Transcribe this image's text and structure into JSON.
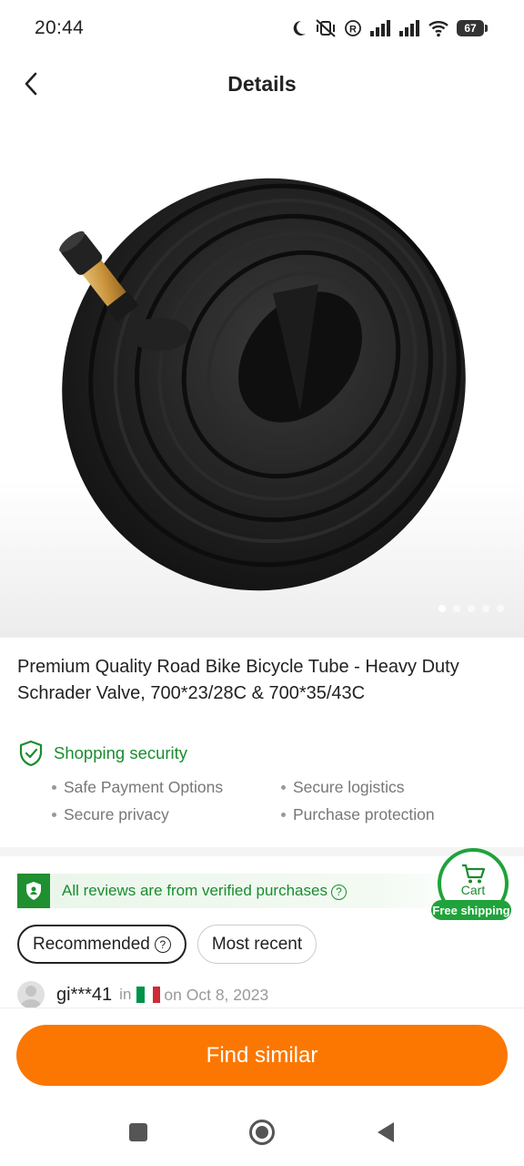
{
  "status_bar": {
    "time": "20:44",
    "battery": "67",
    "icons": [
      "moon-icon",
      "mute-vibrate-icon",
      "registered-icon",
      "signal-icon",
      "signal-icon",
      "wifi-icon",
      "battery-icon"
    ]
  },
  "header": {
    "title": "Details",
    "back_icon": "chevron-left-icon"
  },
  "gallery": {
    "image_name": "bicycle inner tube",
    "total_images": 5,
    "active_index": 1
  },
  "product": {
    "title": "Premium Quality Road Bike Bicycle Tube - Heavy Duty Schrader Valve, 700*23/28C & 700*35/43C"
  },
  "security": {
    "title": "Shopping security",
    "items": [
      "Safe Payment Options",
      "Secure logistics",
      "Secure privacy",
      "Purchase protection"
    ]
  },
  "reviews": {
    "verified_text": "All reviews are from verified purchases",
    "tabs": [
      "Recommended",
      "Most recent"
    ],
    "active_tab": "Recommended",
    "reviewer": {
      "name": "gi***41",
      "in_label": "in",
      "date": "on Oct 8, 2023",
      "country_flag": "italy-flag"
    }
  },
  "cart_badge": {
    "label": "Cart",
    "shipping": "Free shipping"
  },
  "actions": {
    "find_similar": "Find similar"
  },
  "colors": {
    "accent_orange": "#fb7701",
    "security_green": "#1a8c2f",
    "badge_green": "#1fa33a"
  }
}
